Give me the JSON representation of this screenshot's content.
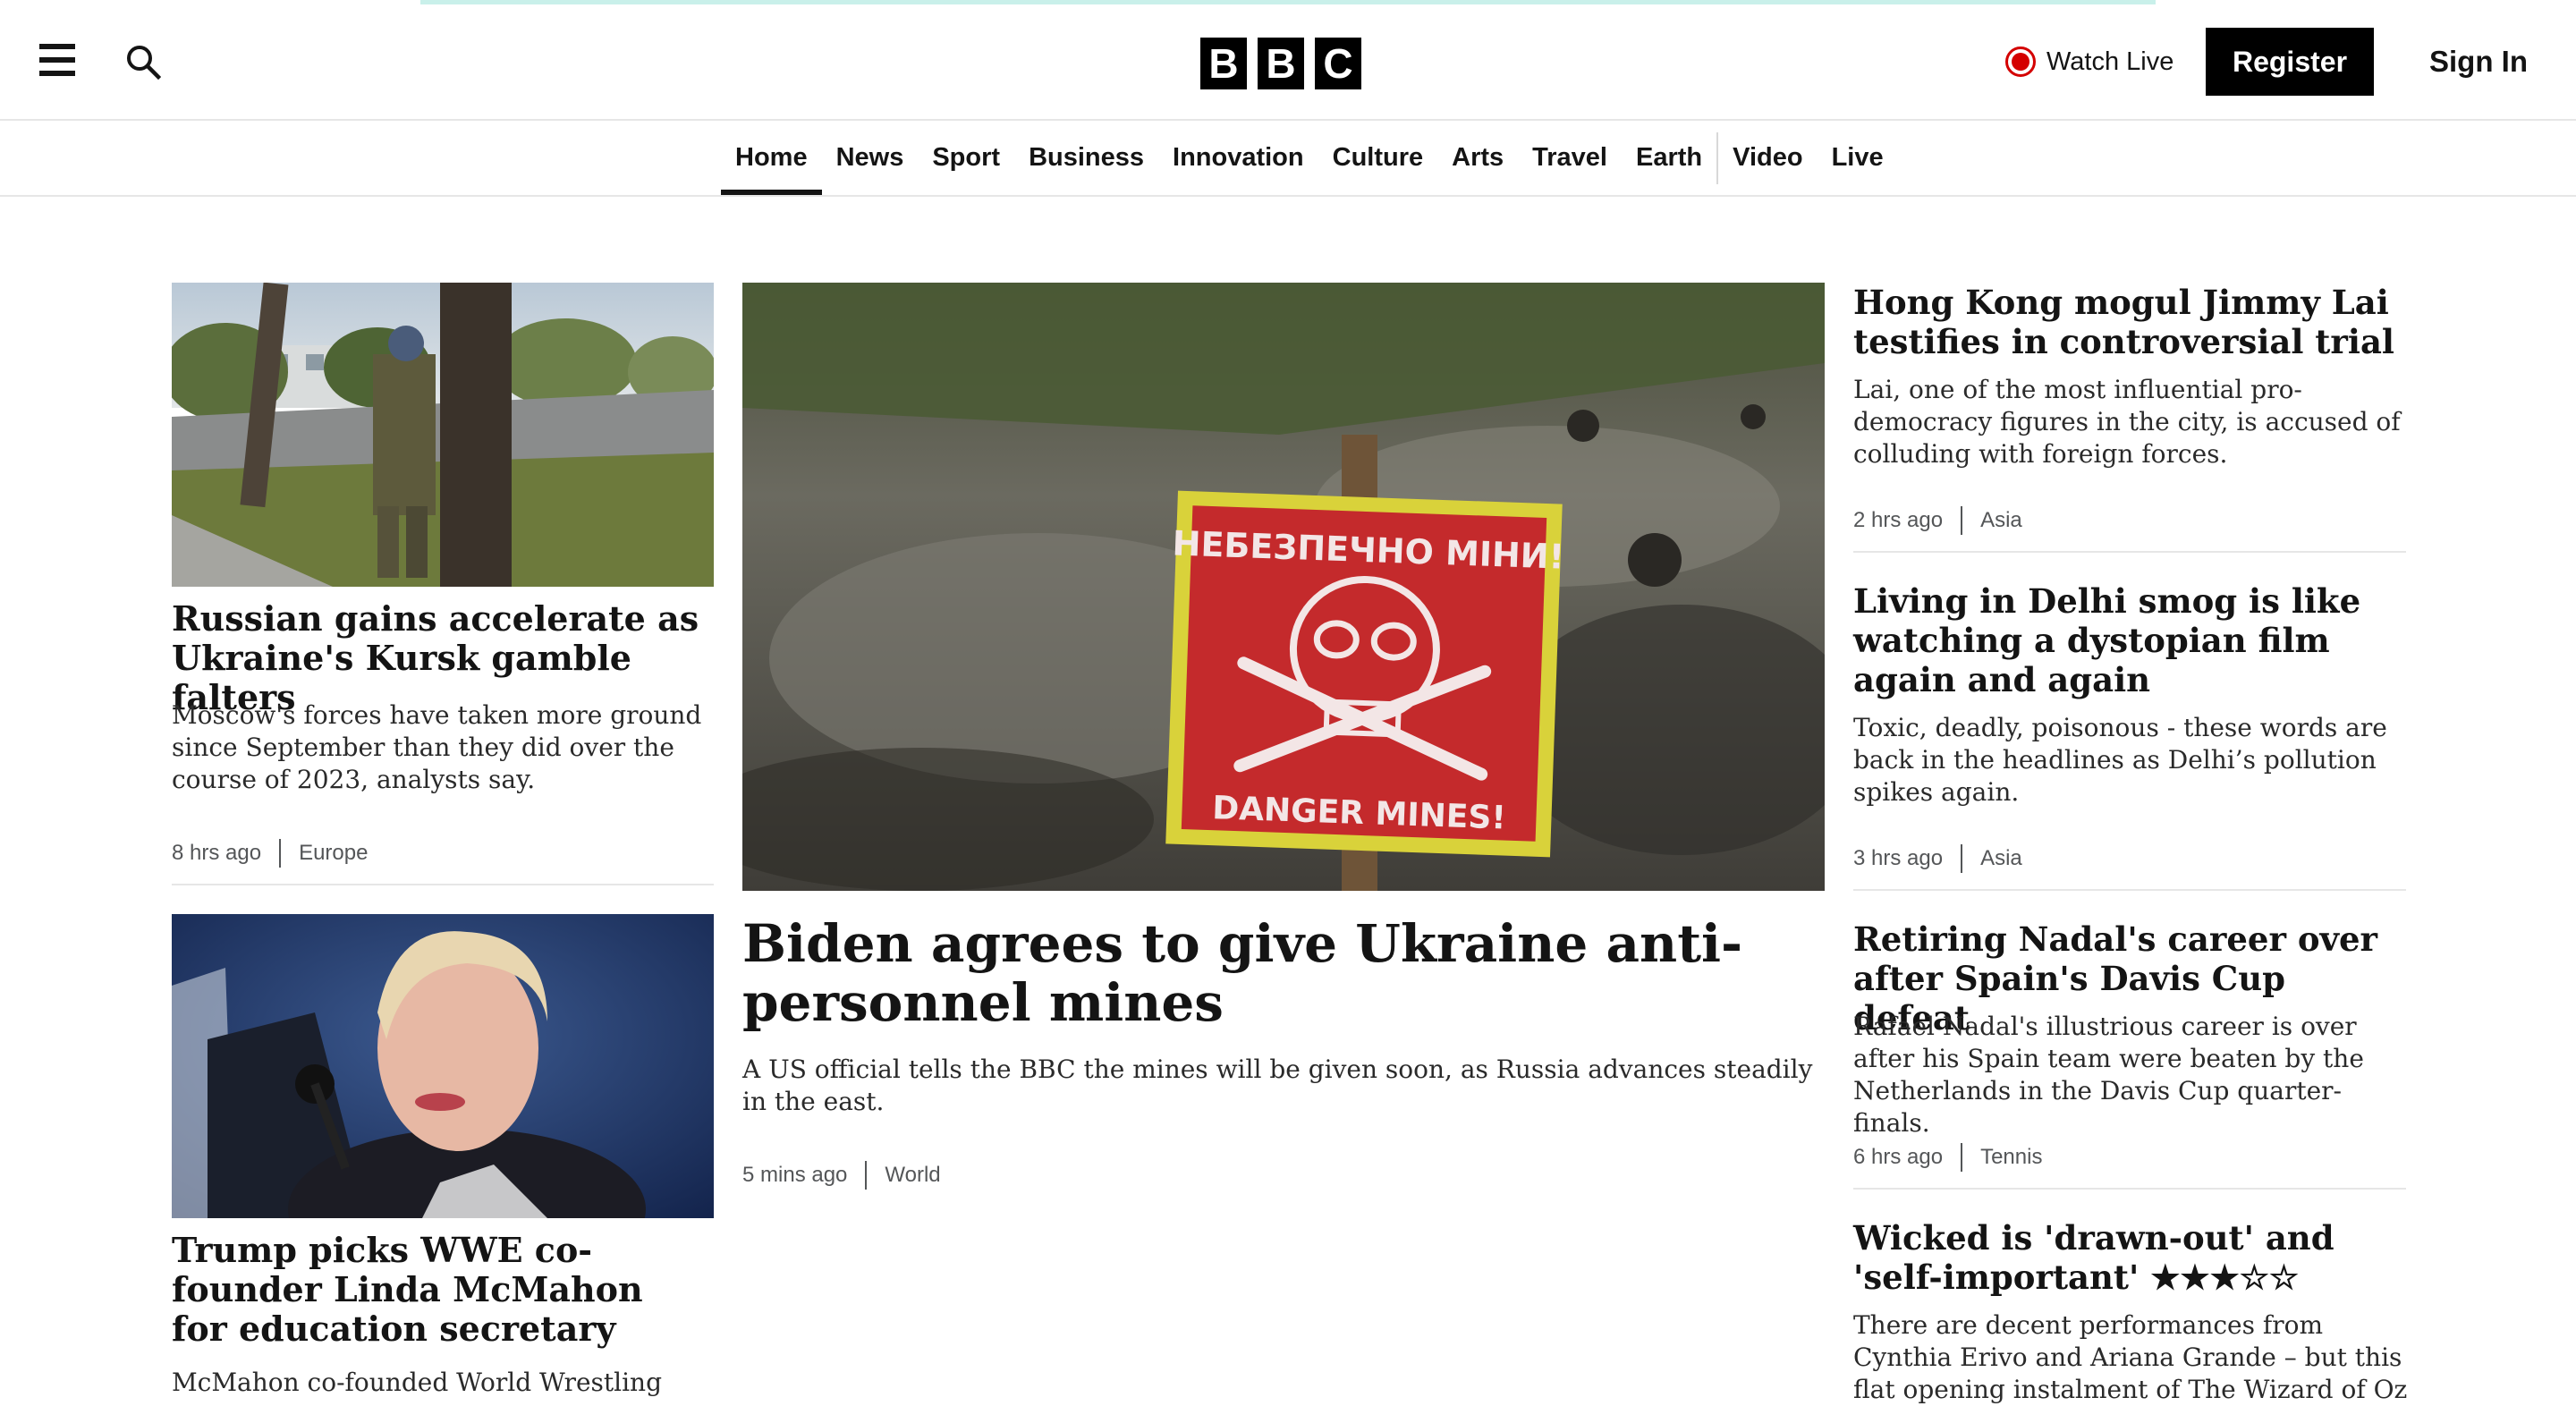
{
  "header": {
    "logo_letters": [
      "B",
      "B",
      "C"
    ],
    "watch_live": "Watch Live",
    "register": "Register",
    "sign_in": "Sign In"
  },
  "nav": {
    "items": [
      "Home",
      "News",
      "Sport",
      "Business",
      "Innovation",
      "Culture",
      "Arts",
      "Travel",
      "Earth",
      "Video",
      "Live"
    ],
    "active": "Home"
  },
  "left_column": [
    {
      "headline": "Russian gains accelerate as Ukraine's Kursk gamble falters",
      "summary": "Moscow's forces have taken more ground since September than they did over the course of 2023, analysts say.",
      "time": "8 hrs ago",
      "tag": "Europe"
    },
    {
      "headline": "Trump picks WWE co-founder Linda McMahon for education secretary",
      "summary": "McMahon co-founded World Wrestling"
    }
  ],
  "lead": {
    "sign_top": "НЕБЕЗПЕЧНО МІНИ!",
    "sign_bottom": "DANGER MINES!",
    "headline": "Biden agrees to give Ukraine anti-personnel mines",
    "summary": "A US official tells the BBC the mines will be given soon, as Russia advances steadily in the east.",
    "time": "5 mins ago",
    "tag": "World"
  },
  "right_column": [
    {
      "headline": "Hong Kong mogul Jimmy Lai testifies in controversial trial",
      "summary": "Lai, one of the most influential pro-democracy figures in the city, is accused of colluding with foreign forces.",
      "time": "2 hrs ago",
      "tag": "Asia"
    },
    {
      "headline": "Living in Delhi smog is like watching a dystopian film again and again",
      "summary": "Toxic, deadly, poisonous - these words are back in the headlines as Delhi’s pollution spikes again.",
      "time": "3 hrs ago",
      "tag": "Asia"
    },
    {
      "headline": "Retiring Nadal's career over after Spain's Davis Cup defeat",
      "summary": "Rafael Nadal's illustrious career is over after his Spain team were beaten by the Netherlands in the Davis Cup quarter-finals.",
      "time": "6 hrs ago",
      "tag": "Tennis"
    },
    {
      "headline": "Wicked is 'drawn-out' and 'self-important' ★★★☆☆",
      "summary": "There are decent performances from Cynthia Erivo and Ariana Grande – but this flat opening instalment of The Wizard of Oz"
    }
  ],
  "icons": {
    "menu": "menu-icon",
    "search": "search-icon",
    "live": "live-indicator-icon"
  },
  "colors": {
    "live_red": "#d40000",
    "brand_black": "#000000",
    "accent_line": "#c9f0ea"
  }
}
